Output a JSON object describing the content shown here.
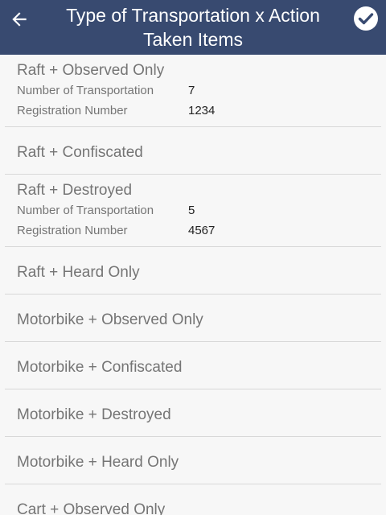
{
  "header": {
    "title_line1": "Type of Transportation x Action",
    "title_line2": "Taken Items",
    "background": "#384a70",
    "back_icon": "arrow-left-icon",
    "confirm_icon": "check-circle-icon"
  },
  "items": [
    {
      "title": "Raft + Observed Only",
      "details": [
        {
          "label": "Number of Transportation",
          "value": "7"
        },
        {
          "label": "Registration Number",
          "value": "1234"
        }
      ]
    },
    {
      "title": "Raft + Confiscated"
    },
    {
      "title": "Raft + Destroyed",
      "details": [
        {
          "label": "Number of Transportation",
          "value": "5"
        },
        {
          "label": "Registration Number",
          "value": "4567"
        }
      ]
    },
    {
      "title": "Raft + Heard Only"
    },
    {
      "title": "Motorbike + Observed Only"
    },
    {
      "title": "Motorbike + Confiscated"
    },
    {
      "title": "Motorbike + Destroyed"
    },
    {
      "title": "Motorbike + Heard Only"
    },
    {
      "title": "Cart + Observed Only"
    }
  ]
}
